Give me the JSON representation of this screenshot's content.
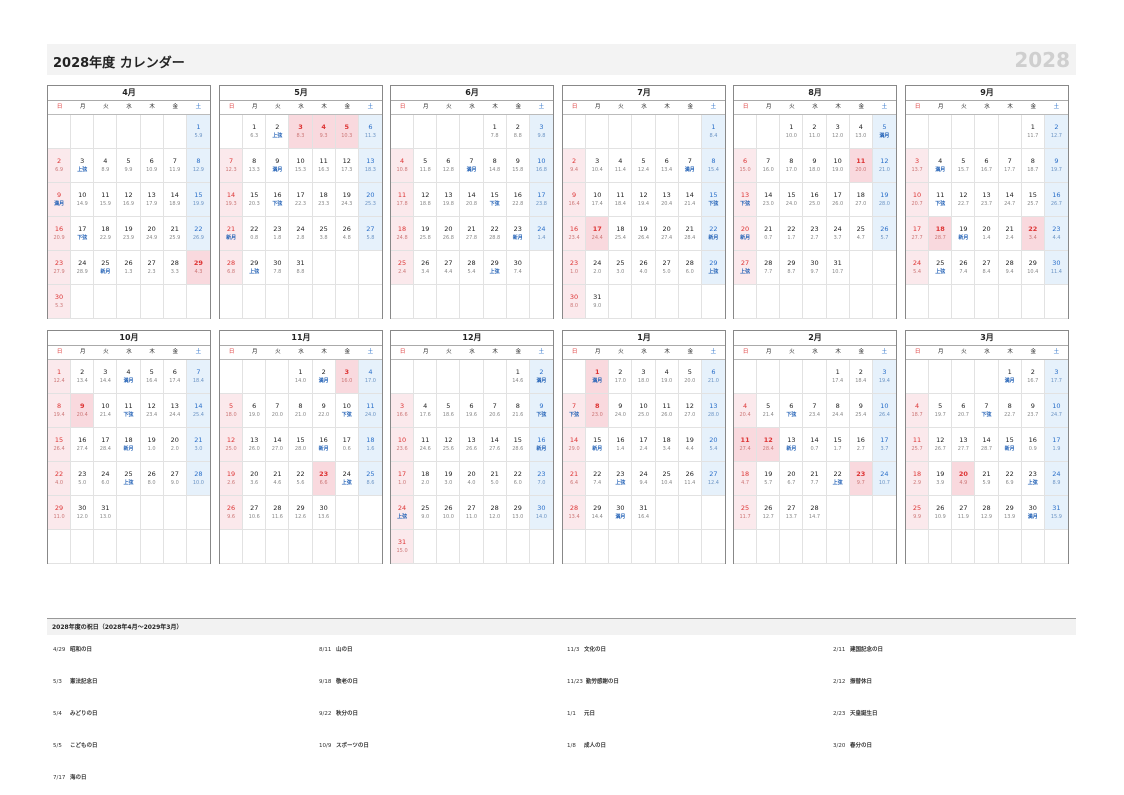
{
  "header": {
    "title": "2028年度 カレンダー",
    "year": "2028"
  },
  "weekdays": [
    "日",
    "月",
    "火",
    "水",
    "木",
    "金",
    "土"
  ],
  "months": [
    {
      "name": "4月",
      "start": 6,
      "days": 30,
      "holidays": [
        29
      ],
      "sub": [
        "5.9",
        "6.9",
        "上弦",
        "8.9",
        "9.9",
        "10.9",
        "11.9",
        "12.9",
        "満月",
        "14.9",
        "15.9",
        "16.9",
        "17.9",
        "18.9",
        "19.9",
        "20.9",
        "下弦",
        "22.9",
        "23.9",
        "24.9",
        "25.9",
        "26.9",
        "27.9",
        "28.9",
        "新月",
        "1.3",
        "2.3",
        "3.3",
        "4.3",
        "5.3"
      ]
    },
    {
      "name": "5月",
      "start": 1,
      "days": 31,
      "holidays": [
        3,
        4,
        5
      ],
      "sub": [
        "6.3",
        "上弦",
        "8.3",
        "9.3",
        "10.3",
        "11.3",
        "12.3",
        "13.3",
        "満月",
        "15.3",
        "16.3",
        "17.3",
        "18.3",
        "19.3",
        "20.3",
        "下弦",
        "22.3",
        "23.3",
        "24.3",
        "25.3",
        "新月",
        "0.8",
        "1.8",
        "2.8",
        "3.8",
        "4.8",
        "5.8",
        "6.8",
        "上弦",
        "7.8",
        "8.8"
      ]
    },
    {
      "name": "6月",
      "start": 4,
      "days": 30,
      "holidays": [],
      "sub": [
        "7.8",
        "8.8",
        "9.8",
        "10.8",
        "11.8",
        "12.8",
        "満月",
        "14.8",
        "15.8",
        "16.8",
        "17.8",
        "18.8",
        "19.8",
        "20.8",
        "下弦",
        "22.8",
        "23.8",
        "24.8",
        "25.8",
        "26.8",
        "27.8",
        "28.8",
        "新月",
        "1.4",
        "2.4",
        "3.4",
        "4.4",
        "5.4",
        "上弦",
        "7.4"
      ]
    },
    {
      "name": "7月",
      "start": 6,
      "days": 31,
      "holidays": [
        17
      ],
      "sub": [
        "8.4",
        "9.4",
        "10.4",
        "11.4",
        "12.4",
        "13.4",
        "満月",
        "15.4",
        "16.4",
        "17.4",
        "18.4",
        "19.4",
        "20.4",
        "21.4",
        "下弦",
        "23.4",
        "24.4",
        "25.4",
        "26.4",
        "27.4",
        "28.4",
        "新月",
        "1.0",
        "2.0",
        "3.0",
        "4.0",
        "5.0",
        "6.0",
        "上弦",
        "8.0",
        "9.0"
      ]
    },
    {
      "name": "8月",
      "start": 2,
      "days": 31,
      "holidays": [
        11
      ],
      "sub": [
        "10.0",
        "11.0",
        "12.0",
        "13.0",
        "満月",
        "15.0",
        "16.0",
        "17.0",
        "18.0",
        "19.0",
        "20.0",
        "21.0",
        "下弦",
        "23.0",
        "24.0",
        "25.0",
        "26.0",
        "27.0",
        "28.0",
        "新月",
        "0.7",
        "1.7",
        "2.7",
        "3.7",
        "4.7",
        "5.7",
        "上弦",
        "7.7",
        "8.7",
        "9.7",
        "10.7"
      ]
    },
    {
      "name": "9月",
      "start": 5,
      "days": 30,
      "holidays": [
        18,
        22
      ],
      "sub": [
        "11.7",
        "12.7",
        "13.7",
        "満月",
        "15.7",
        "16.7",
        "17.7",
        "18.7",
        "19.7",
        "20.7",
        "下弦",
        "22.7",
        "23.7",
        "24.7",
        "25.7",
        "26.7",
        "27.7",
        "28.7",
        "新月",
        "1.4",
        "2.4",
        "3.4",
        "4.4",
        "5.4",
        "上弦",
        "7.4",
        "8.4",
        "9.4",
        "10.4",
        "11.4"
      ]
    },
    {
      "name": "10月",
      "start": 0,
      "days": 31,
      "holidays": [
        9
      ],
      "sub": [
        "12.4",
        "13.4",
        "14.4",
        "満月",
        "16.4",
        "17.4",
        "18.4",
        "19.4",
        "20.4",
        "21.4",
        "下弦",
        "23.4",
        "24.4",
        "25.4",
        "26.4",
        "27.4",
        "28.4",
        "新月",
        "1.0",
        "2.0",
        "3.0",
        "4.0",
        "5.0",
        "6.0",
        "上弦",
        "8.0",
        "9.0",
        "10.0",
        "11.0",
        "12.0",
        "13.0"
      ]
    },
    {
      "name": "11月",
      "start": 3,
      "days": 30,
      "holidays": [
        3,
        23
      ],
      "sub": [
        "14.0",
        "満月",
        "16.0",
        "17.0",
        "18.0",
        "19.0",
        "20.0",
        "21.0",
        "22.0",
        "下弦",
        "24.0",
        "25.0",
        "26.0",
        "27.0",
        "28.0",
        "新月",
        "0.6",
        "1.6",
        "2.6",
        "3.6",
        "4.6",
        "5.6",
        "6.6",
        "上弦",
        "8.6",
        "9.6",
        "10.6",
        "11.6",
        "12.6",
        "13.6"
      ]
    },
    {
      "name": "12月",
      "start": 5,
      "days": 31,
      "holidays": [],
      "sub": [
        "14.6",
        "満月",
        "16.6",
        "17.6",
        "18.6",
        "19.6",
        "20.6",
        "21.6",
        "下弦",
        "23.6",
        "24.6",
        "25.6",
        "26.6",
        "27.6",
        "28.6",
        "新月",
        "1.0",
        "2.0",
        "3.0",
        "4.0",
        "5.0",
        "6.0",
        "7.0",
        "上弦",
        "9.0",
        "10.0",
        "11.0",
        "12.0",
        "13.0",
        "14.0",
        "15.0"
      ]
    },
    {
      "name": "1月",
      "start": 1,
      "days": 31,
      "holidays": [
        1,
        8
      ],
      "sub": [
        "満月",
        "17.0",
        "18.0",
        "19.0",
        "20.0",
        "21.0",
        "下弦",
        "23.0",
        "24.0",
        "25.0",
        "26.0",
        "27.0",
        "28.0",
        "29.0",
        "新月",
        "1.4",
        "2.4",
        "3.4",
        "4.4",
        "5.4",
        "6.4",
        "7.4",
        "上弦",
        "9.4",
        "10.4",
        "11.4",
        "12.4",
        "13.4",
        "14.4",
        "満月",
        "16.4"
      ]
    },
    {
      "name": "2月",
      "start": 4,
      "days": 28,
      "holidays": [
        11,
        12,
        23
      ],
      "sub": [
        "17.4",
        "18.4",
        "19.4",
        "20.4",
        "21.4",
        "下弦",
        "23.4",
        "24.4",
        "25.4",
        "26.4",
        "27.4",
        "28.4",
        "新月",
        "0.7",
        "1.7",
        "2.7",
        "3.7",
        "4.7",
        "5.7",
        "6.7",
        "7.7",
        "上弦",
        "9.7",
        "10.7",
        "11.7",
        "12.7",
        "13.7",
        "14.7"
      ]
    },
    {
      "name": "3月",
      "start": 4,
      "days": 31,
      "holidays": [
        20
      ],
      "sub": [
        "満月",
        "16.7",
        "17.7",
        "18.7",
        "19.7",
        "20.7",
        "下弦",
        "22.7",
        "23.7",
        "24.7",
        "25.7",
        "26.7",
        "27.7",
        "28.7",
        "新月",
        "0.9",
        "1.9",
        "2.9",
        "3.9",
        "4.9",
        "5.9",
        "6.9",
        "上弦",
        "8.9",
        "9.9",
        "10.9",
        "11.9",
        "12.9",
        "13.9",
        "満月",
        "15.9"
      ]
    }
  ],
  "holidays_title": "2028年度の祝日（2028年4月～2029年3月）",
  "holiday_columns": [
    [
      {
        "date": "4/29",
        "name": "昭和の日"
      },
      {
        "date": "5/3",
        "name": "憲法記念日"
      },
      {
        "date": "5/4",
        "name": "みどりの日"
      },
      {
        "date": "5/5",
        "name": "こどもの日"
      },
      {
        "date": "7/17",
        "name": "海の日"
      }
    ],
    [
      {
        "date": "8/11",
        "name": "山の日"
      },
      {
        "date": "9/18",
        "name": "敬老の日"
      },
      {
        "date": "9/22",
        "name": "秋分の日"
      },
      {
        "date": "10/9",
        "name": "スポーツの日"
      }
    ],
    [
      {
        "date": "11/3",
        "name": "文化の日"
      },
      {
        "date": "11/23",
        "name": "勤労感謝の日"
      },
      {
        "date": "1/1",
        "name": "元日"
      },
      {
        "date": "1/8",
        "name": "成人の日"
      }
    ],
    [
      {
        "date": "2/11",
        "name": "建国記念の日"
      },
      {
        "date": "2/12",
        "name": "振替休日"
      },
      {
        "date": "2/23",
        "name": "天皇誕生日"
      },
      {
        "date": "3/20",
        "name": "春分の日"
      }
    ]
  ]
}
